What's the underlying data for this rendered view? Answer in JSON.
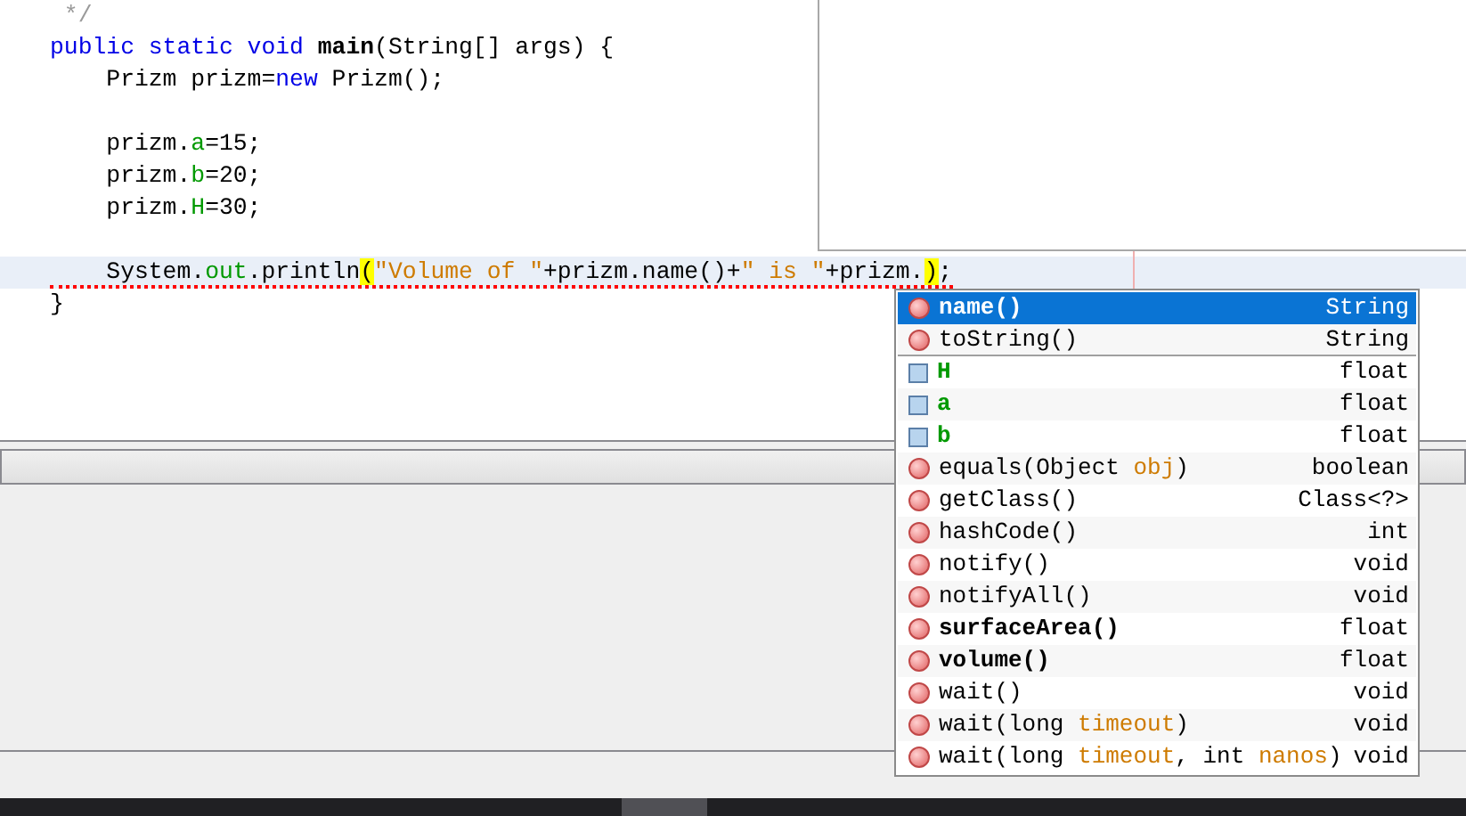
{
  "editor": {
    "lines": [
      {
        "current": false,
        "error": false,
        "tokens": [
          {
            "text": " */",
            "kind": "comment"
          }
        ]
      },
      {
        "current": false,
        "error": false,
        "tokens": [
          {
            "text": "public static void ",
            "kind": "keyword"
          },
          {
            "text": "main",
            "kind": "bold"
          },
          {
            "text": "(String[] args) {",
            "kind": "plain"
          }
        ]
      },
      {
        "current": false,
        "error": false,
        "tokens": [
          {
            "text": "    Prizm prizm=",
            "kind": "plain"
          },
          {
            "text": "new",
            "kind": "keyword"
          },
          {
            "text": " Prizm();",
            "kind": "plain"
          }
        ]
      },
      {
        "blank": true
      },
      {
        "current": false,
        "error": false,
        "tokens": [
          {
            "text": "    prizm.",
            "kind": "plain"
          },
          {
            "text": "a",
            "kind": "field"
          },
          {
            "text": "=15;",
            "kind": "plain"
          }
        ]
      },
      {
        "current": false,
        "error": false,
        "tokens": [
          {
            "text": "    prizm.",
            "kind": "plain"
          },
          {
            "text": "b",
            "kind": "field"
          },
          {
            "text": "=20;",
            "kind": "plain"
          }
        ]
      },
      {
        "current": false,
        "error": false,
        "tokens": [
          {
            "text": "    prizm.",
            "kind": "plain"
          },
          {
            "text": "H",
            "kind": "field"
          },
          {
            "text": "=30;",
            "kind": "plain"
          }
        ]
      },
      {
        "blank": true
      },
      {
        "current": true,
        "error": true,
        "tokens": [
          {
            "text": "    System.",
            "kind": "plain"
          },
          {
            "text": "out",
            "kind": "field"
          },
          {
            "text": ".println",
            "kind": "plain"
          },
          {
            "text": "(",
            "kind": "match"
          },
          {
            "text": "\"Volume of \"",
            "kind": "string"
          },
          {
            "text": "+prizm.name()+",
            "kind": "plain"
          },
          {
            "text": "\" is \"",
            "kind": "string"
          },
          {
            "text": "+prizm.",
            "kind": "plain"
          },
          {
            "text": ")",
            "kind": "match"
          },
          {
            "text": ";",
            "kind": "plain"
          }
        ]
      },
      {
        "current": false,
        "error": false,
        "tokens": [
          {
            "text": "}",
            "kind": "plain"
          }
        ]
      }
    ]
  },
  "completion": {
    "items": [
      {
        "kind": "method",
        "own": true,
        "selected": true,
        "label": [
          {
            "text": "name()"
          }
        ],
        "type": "String"
      },
      {
        "kind": "method",
        "own": false,
        "selected": false,
        "label": [
          {
            "text": "toString()"
          }
        ],
        "type": "String"
      },
      {
        "kind": "field",
        "own": true,
        "selected": false,
        "label": [
          {
            "text": "H"
          }
        ],
        "type": "float"
      },
      {
        "kind": "field",
        "own": true,
        "selected": false,
        "label": [
          {
            "text": "a"
          }
        ],
        "type": "float"
      },
      {
        "kind": "field",
        "own": true,
        "selected": false,
        "label": [
          {
            "text": "b"
          }
        ],
        "type": "float"
      },
      {
        "kind": "method",
        "own": false,
        "selected": false,
        "label": [
          {
            "text": "equals(Object "
          },
          {
            "text": "obj",
            "param": true
          },
          {
            "text": ")"
          }
        ],
        "type": "boolean"
      },
      {
        "kind": "method",
        "own": false,
        "selected": false,
        "label": [
          {
            "text": "getClass()"
          }
        ],
        "type": "Class<?>"
      },
      {
        "kind": "method",
        "own": false,
        "selected": false,
        "label": [
          {
            "text": "hashCode()"
          }
        ],
        "type": "int"
      },
      {
        "kind": "method",
        "own": false,
        "selected": false,
        "label": [
          {
            "text": "notify()"
          }
        ],
        "type": "void"
      },
      {
        "kind": "method",
        "own": false,
        "selected": false,
        "label": [
          {
            "text": "notifyAll()"
          }
        ],
        "type": "void"
      },
      {
        "kind": "method",
        "own": true,
        "selected": false,
        "label": [
          {
            "text": "surfaceArea()"
          }
        ],
        "type": "float"
      },
      {
        "kind": "method",
        "own": true,
        "selected": false,
        "label": [
          {
            "text": "volume()"
          }
        ],
        "type": "float"
      },
      {
        "kind": "method",
        "own": false,
        "selected": false,
        "label": [
          {
            "text": "wait()"
          }
        ],
        "type": "void"
      },
      {
        "kind": "method",
        "own": false,
        "selected": false,
        "label": [
          {
            "text": "wait(long "
          },
          {
            "text": "timeout",
            "param": true
          },
          {
            "text": ")"
          }
        ],
        "type": "void"
      },
      {
        "kind": "method",
        "own": false,
        "selected": false,
        "label": [
          {
            "text": "wait(long "
          },
          {
            "text": "timeout",
            "param": true
          },
          {
            "text": ", int "
          },
          {
            "text": "nanos",
            "param": true
          },
          {
            "text": ")"
          }
        ],
        "type": "void"
      }
    ]
  }
}
